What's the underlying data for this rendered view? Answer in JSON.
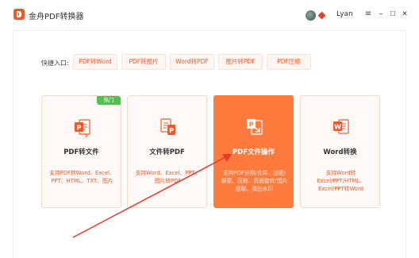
{
  "app": {
    "title": "金舟PDF转换器",
    "user_name": "Lyan"
  },
  "window_controls": {
    "menu": "≡",
    "minimize": "–",
    "maximize": "☐",
    "close": "✕"
  },
  "quick_entry": {
    "label": "快捷入口:",
    "items": [
      "PDF转Word",
      "PDF转图片",
      "Word转PDF",
      "图片转PDF",
      "PDF压缩"
    ]
  },
  "cards": [
    {
      "title": "PDF转文件",
      "desc": "支持PDF转Word、Excel、PPT、HTML、TXT、图片",
      "badge": "热门",
      "icon": "pdf-convert-icon",
      "icon_letter": "P"
    },
    {
      "title": "文件转PDF",
      "desc": "支持Word、Excel、PPT、图片转PDF",
      "icon": "file-to-pdf-icon",
      "icon_letter": "P"
    },
    {
      "title": "PDF文件操作",
      "desc": "支持PDF分割/合并、加密/解密、压缩、页面旋转/图片提取、添加水印",
      "icon": "pdf-operate-icon",
      "icon_letter": "P"
    },
    {
      "title": "Word转换",
      "desc": "支持Word转Excel/PPT/HTML、Excel/PPT转Word",
      "icon": "word-convert-icon",
      "icon_letter": "W"
    }
  ],
  "colors": {
    "accent": "#f2592a",
    "card_active": "#ff7a3d",
    "badge": "#4fc24f",
    "arrow": "#e53a2a"
  }
}
